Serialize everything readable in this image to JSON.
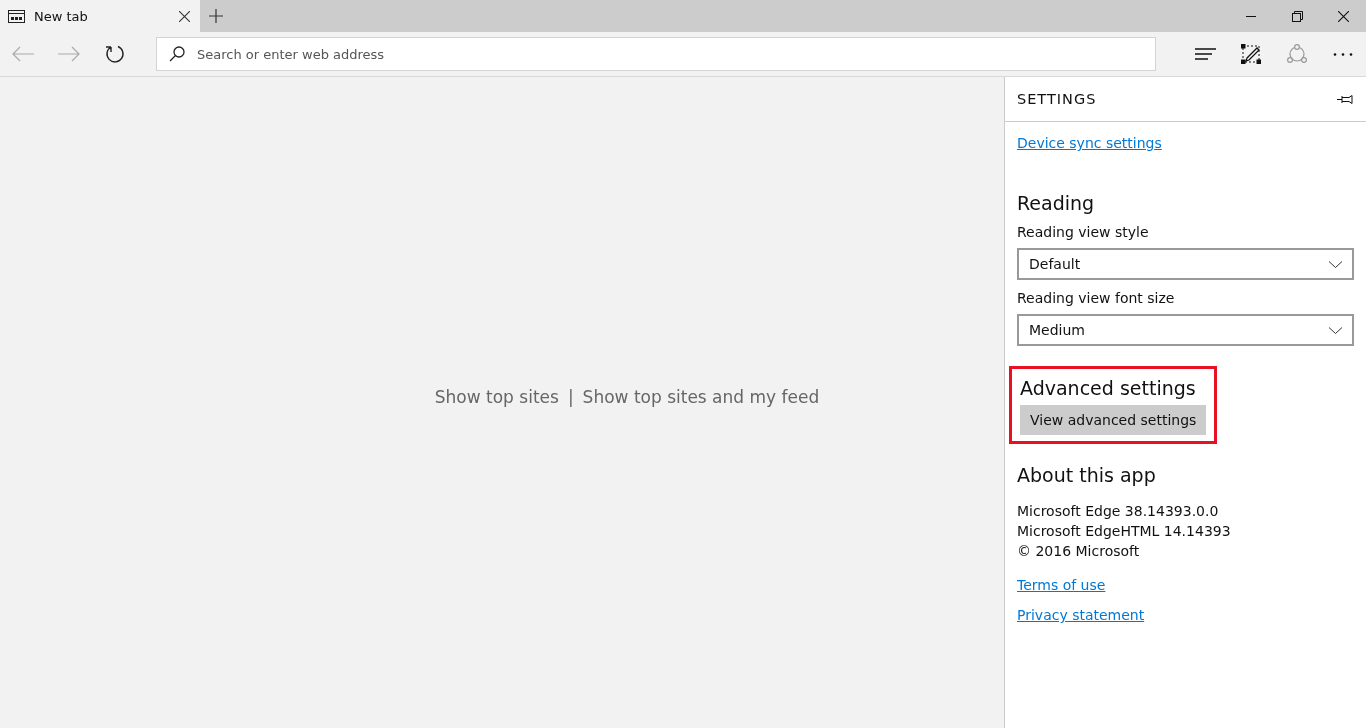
{
  "tab": {
    "title": "New tab",
    "selected": true
  },
  "address_bar": {
    "placeholder": "Search or enter web address"
  },
  "new_tab_page": {
    "options": [
      {
        "label": "Show top sites"
      },
      {
        "label": "Show top sites and my feed"
      }
    ],
    "separator": "|"
  },
  "settings": {
    "title": "SETTINGS",
    "sync_link": "Device sync settings",
    "reading": {
      "heading": "Reading",
      "fields": [
        {
          "label": "Reading view style",
          "value": "Default"
        },
        {
          "label": "Reading view font size",
          "value": "Medium"
        }
      ]
    },
    "advanced": {
      "heading": "Advanced settings",
      "button": "View advanced settings",
      "highlighted": true
    },
    "about": {
      "heading": "About this app",
      "lines": [
        "Microsoft Edge 38.14393.0.0",
        "Microsoft EdgeHTML 14.14393",
        "© 2016 Microsoft"
      ],
      "links": [
        "Terms of use",
        "Privacy statement"
      ]
    }
  }
}
